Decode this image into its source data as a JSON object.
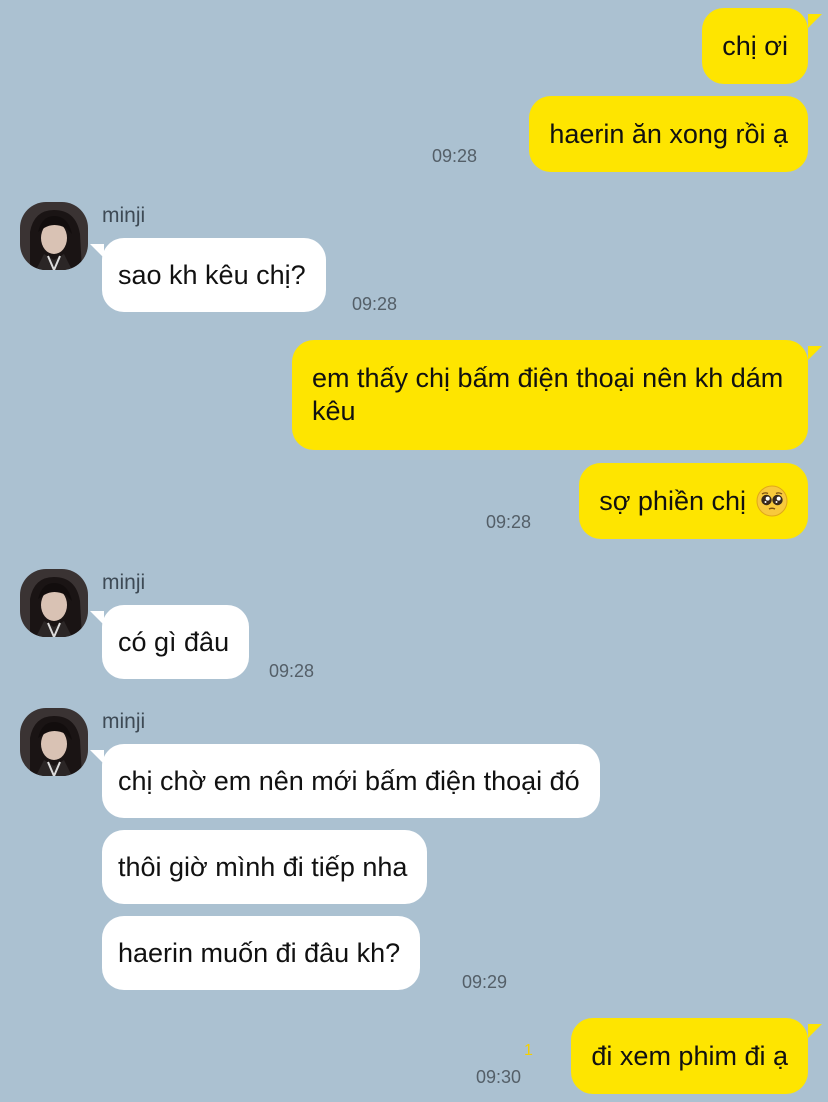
{
  "contact": {
    "name": "minji"
  },
  "messages": {
    "m1": {
      "text": "chị ơi"
    },
    "m2": {
      "text": "haerin ăn xong rồi ạ",
      "time": "09:28"
    },
    "m3": {
      "text": "sao kh kêu chị?",
      "time": "09:28"
    },
    "m4": {
      "text": "em thấy chị bấm điện thoại nên kh dám kêu"
    },
    "m5": {
      "text": "sợ phiền chị",
      "emoji": "pleading-face",
      "time": "09:28"
    },
    "m6": {
      "text": "có gì đâu",
      "time": "09:28"
    },
    "m7": {
      "text": "chị chờ em nên mới bấm điện thoại đó"
    },
    "m8": {
      "text": "thôi giờ mình đi tiếp nha"
    },
    "m9": {
      "text": "haerin muốn đi đâu kh?",
      "time": "09:29"
    },
    "m10": {
      "text": "đi xem phim đi ạ",
      "time": "09:30",
      "unread_count": "1"
    }
  },
  "colors": {
    "background": "#abc1d1",
    "my_bubble": "#fee500",
    "their_bubble": "#ffffff",
    "timestamp": "#545f68",
    "unread": "#f4cf00"
  },
  "icons": {
    "avatar": "profile-photo",
    "emoji": "pleading-face"
  }
}
